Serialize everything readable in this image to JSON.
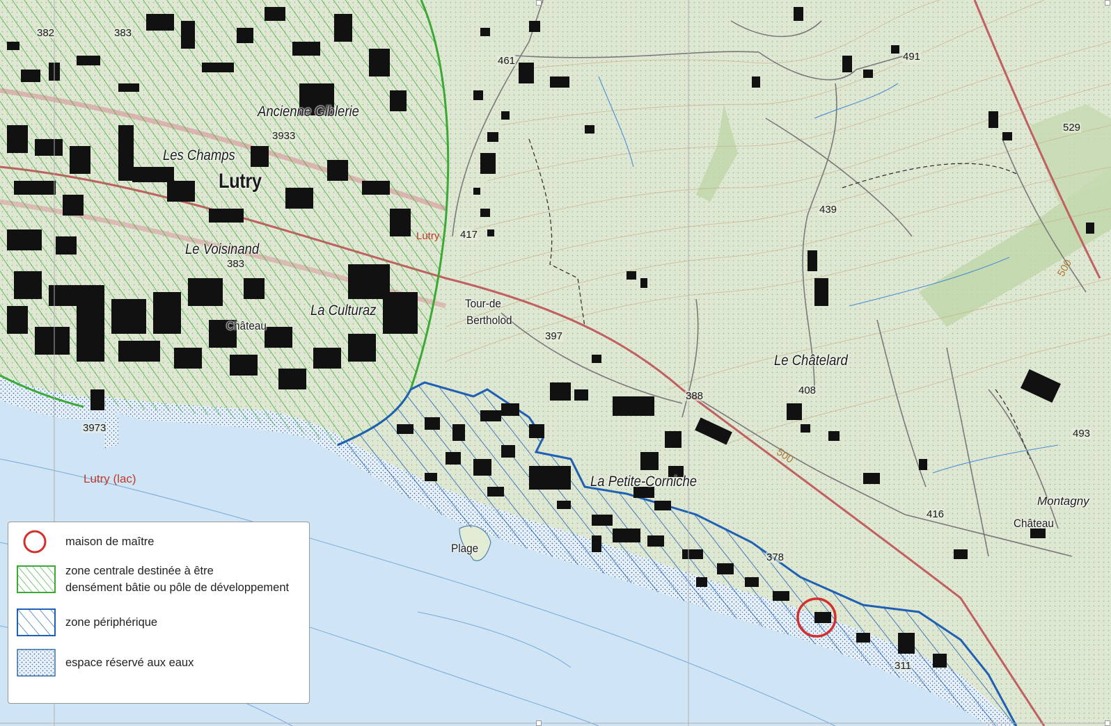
{
  "map": {
    "colors": {
      "terrain": "#dfe8d4",
      "water": "#cfe4f4",
      "central_zone": "#3aaa35",
      "peripheral_zone": "#1f5fb4",
      "marker": "#d32f2f",
      "railway": "#c06060",
      "buildings": "#111111"
    },
    "places": {
      "lutry": "Lutry",
      "ancienne_giblerie": "Ancienne Giblerie",
      "les_champs": "Les Champs",
      "le_voisinand": "Le Voisinand",
      "la_culturaz": "La Culturaz",
      "chateau_lutry": "Château",
      "tour_de": "Tour-de",
      "bertholod": "Bertholod",
      "le_chatelard": "Le Châtelard",
      "la_petite_corniche": "La Petite-Corniche",
      "plage": "Plage",
      "montagny": "Montagny",
      "chateau_montagny": "Château",
      "lutry_station": "Lutry",
      "lutry_lac": "Lutry (lac)"
    },
    "altitudes": {
      "a1": "382",
      "a2": "383",
      "a3": "3933",
      "a4": "383",
      "a5": "461",
      "a6": "417",
      "a7": "397",
      "a8": "388",
      "a9": "408",
      "a10": "439",
      "a11": "491",
      "a12": "529",
      "a13": "493",
      "a14": "416",
      "a15": "378",
      "a16": "311",
      "a17": "3973",
      "c1": "500",
      "c2": "500"
    }
  },
  "legend": {
    "items": [
      {
        "key": "maison",
        "label": "maison de maître"
      },
      {
        "key": "central",
        "label_line1": "zone centrale destinée à être",
        "label_line2": "densément bâtie ou pôle de développement"
      },
      {
        "key": "peripheral",
        "label": "zone périphérique"
      },
      {
        "key": "water",
        "label": "espace réservé aux eaux"
      }
    ]
  }
}
